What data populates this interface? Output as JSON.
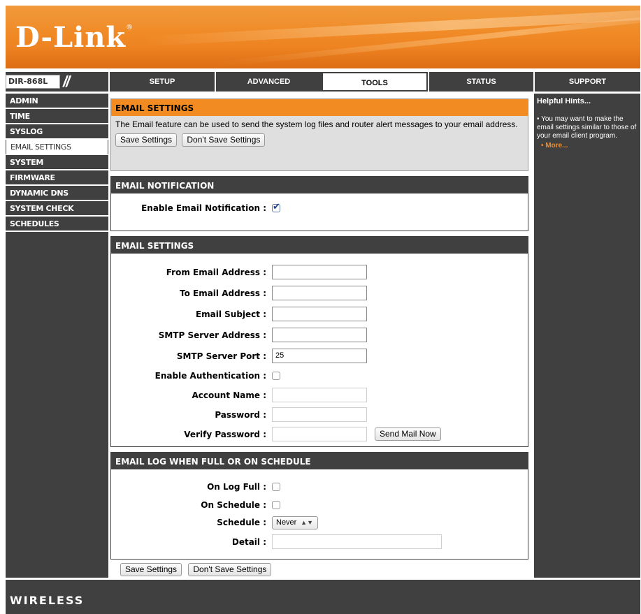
{
  "brand": {
    "logo": "D-Link",
    "trademark": "®"
  },
  "model": "DIR-868L",
  "nav": {
    "tabs": [
      "SETUP",
      "ADVANCED",
      "TOOLS",
      "STATUS",
      "SUPPORT"
    ],
    "active": "TOOLS"
  },
  "sidebar": {
    "items": [
      {
        "label": "ADMIN"
      },
      {
        "label": "TIME"
      },
      {
        "label": "SYSLOG"
      },
      {
        "label": "EMAIL SETTINGS"
      },
      {
        "label": "SYSTEM"
      },
      {
        "label": "FIRMWARE"
      },
      {
        "label": "DYNAMIC DNS"
      },
      {
        "label": "SYSTEM CHECK"
      },
      {
        "label": "SCHEDULES"
      }
    ],
    "active": "EMAIL SETTINGS"
  },
  "intro": {
    "title": "EMAIL SETTINGS",
    "description": "The Email feature can be used to send the system log files and router alert messages to your email address.",
    "save_label": "Save Settings",
    "dont_save_label": "Don't Save Settings"
  },
  "notification": {
    "title": "EMAIL NOTIFICATION",
    "enable_label": "Enable Email Notification :",
    "enabled": true
  },
  "email_settings": {
    "title": "EMAIL SETTINGS",
    "from_label": "From Email Address :",
    "from_value": "",
    "to_label": "To Email Address :",
    "to_value": "",
    "subject_label": "Email Subject :",
    "subject_value": "",
    "smtp_address_label": "SMTP Server Address :",
    "smtp_address_value": "",
    "smtp_port_label": "SMTP Server Port :",
    "smtp_port_value": "25",
    "auth_label": "Enable Authentication :",
    "auth_enabled": false,
    "account_label": "Account Name :",
    "account_value": "",
    "password_label": "Password :",
    "password_value": "",
    "verify_label": "Verify Password :",
    "verify_value": "",
    "send_mail_label": "Send Mail Now"
  },
  "email_log": {
    "title": "EMAIL LOG WHEN FULL OR ON SCHEDULE",
    "log_full_label": "On Log Full :",
    "log_full_checked": false,
    "on_schedule_label": "On Schedule :",
    "on_schedule_checked": false,
    "schedule_label": "Schedule :",
    "schedule_value": "Never",
    "detail_label": "Detail :",
    "detail_value": ""
  },
  "bottom_buttons": {
    "save_label": "Save Settings",
    "dont_save_label": "Don't Save Settings"
  },
  "hints": {
    "title": "Helpful Hints...",
    "text": "• You may want to make the email settings similar to those of your email client program.",
    "more_label": "• More..."
  },
  "footer": {
    "label": "WIRELESS"
  },
  "colors": {
    "accent": "#f18b22",
    "dark": "#404040"
  }
}
